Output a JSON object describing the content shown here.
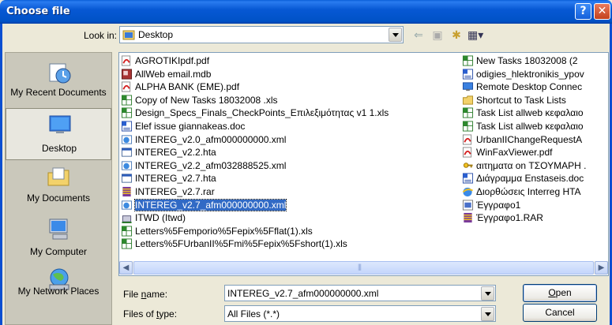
{
  "window": {
    "title": "Choose file",
    "help_label": "?",
    "close_label": "✕"
  },
  "lookin": {
    "label": "Look in:",
    "value": "Desktop"
  },
  "places": [
    {
      "label": "My Recent Documents",
      "icon": "recent-documents-icon"
    },
    {
      "label": "Desktop",
      "icon": "desktop-icon",
      "selected": true
    },
    {
      "label": "My Documents",
      "icon": "my-documents-icon"
    },
    {
      "label": "My Computer",
      "icon": "my-computer-icon"
    },
    {
      "label": "My Network Places",
      "icon": "network-places-icon"
    }
  ],
  "files_col1": [
    {
      "name": "AGROTIKIpdf.pdf",
      "type": "pdf"
    },
    {
      "name": "AllWeb email.mdb",
      "type": "mdb"
    },
    {
      "name": "ALPHA BANK (EME).pdf",
      "type": "pdf"
    },
    {
      "name": "Copy of New Tasks 18032008  .xls",
      "type": "xls"
    },
    {
      "name": "Design_Specs_Finals_CheckPoints_Επιλεξιμότητας v1 1.xls",
      "type": "xls"
    },
    {
      "name": "Elef issue giannakeas.doc",
      "type": "doc"
    },
    {
      "name": "INTEREG_v2.0_afm000000000.xml",
      "type": "xml"
    },
    {
      "name": "INTEREG_v2.2.hta",
      "type": "hta"
    },
    {
      "name": "INTEREG_v2.2_afm032888525.xml",
      "type": "xml"
    },
    {
      "name": "INTEREG_v2.7.hta",
      "type": "hta"
    },
    {
      "name": "INTEREG_v2.7.rar",
      "type": "rar"
    },
    {
      "name": "INTEREG_v2.7_afm000000000.xml",
      "type": "xml",
      "selected": true
    },
    {
      "name": "ITWD (Itwd)",
      "type": "net"
    },
    {
      "name": "Letters%5Femporio%5Fepix%5Fflat(1).xls",
      "type": "xls"
    },
    {
      "name": "Letters%5FUrbanII%5Fmi%5Fepix%5Fshort(1).xls",
      "type": "xls"
    }
  ],
  "files_col2": [
    {
      "name": "New Tasks 18032008  (2",
      "type": "xls"
    },
    {
      "name": "odigies_hlektronikis_ypov",
      "type": "doc"
    },
    {
      "name": "Remote Desktop Connec",
      "type": "rdp"
    },
    {
      "name": "Shortcut to Task Lists",
      "type": "folder"
    },
    {
      "name": "Task List allweb κεφαλαιο",
      "type": "xls"
    },
    {
      "name": "Task List allweb κεφαλαιο",
      "type": "xls"
    },
    {
      "name": "UrbanIIChangeRequestA",
      "type": "pdf"
    },
    {
      "name": "WinFaxViewer.pdf",
      "type": "pdf"
    },
    {
      "name": "αιτηματα on ΤΣΟΥΜΑΡΗ .",
      "type": "key"
    },
    {
      "name": "Διάγραμμα Enstaseis.doc",
      "type": "doc"
    },
    {
      "name": "Διορθώσεις Interreg HTA",
      "type": "ie"
    },
    {
      "name": "Έγγραφο1",
      "type": "app"
    },
    {
      "name": "Έγγραφο1.RAR",
      "type": "rar"
    }
  ],
  "filename": {
    "label_pre": "File ",
    "label_u": "n",
    "label_post": "ame:",
    "value": "INTEREG_v2.7_afm000000000.xml"
  },
  "filetype": {
    "label_pre": "Files of ",
    "label_u": "t",
    "label_post": "ype:",
    "value": "All Files (*.*)"
  },
  "buttons": {
    "open_u": "O",
    "open_rest": "pen",
    "cancel": "Cancel"
  },
  "colors": {
    "titlebar": "#0052c6",
    "selection": "#316ac5",
    "panel": "#ece9d8"
  }
}
